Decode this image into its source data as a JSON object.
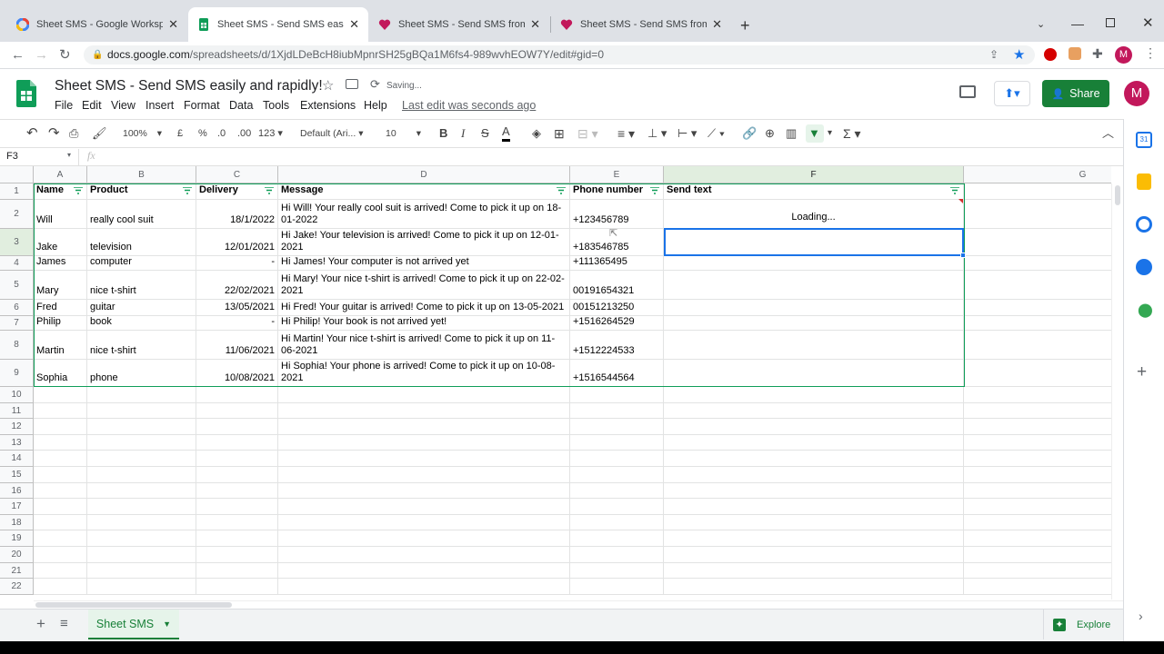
{
  "browser": {
    "tabs": [
      {
        "title": "Sheet SMS - Google Workspace M",
        "icon": "google-workspace-icon"
      },
      {
        "title": "Sheet SMS - Send SMS easily and",
        "icon": "sheets-icon"
      },
      {
        "title": "Sheet SMS - Send SMS from Goo",
        "icon": "heart-icon"
      },
      {
        "title": "Sheet SMS - Send SMS from Goo",
        "icon": "heart-icon"
      }
    ],
    "url_host": "docs.google.com",
    "url_path": "/spreadsheets/d/1XjdLDeBcH8iubMpnrSH25gBQa1M6fs4-989wvhEOW7Y/edit#gid=0",
    "profile_initial": "M"
  },
  "doc": {
    "title": "Sheet SMS - Send SMS easily and rapidly!",
    "status": "Saving...",
    "last_edit": "Last edit was seconds ago",
    "share_label": "Share",
    "avatar_initial": "M",
    "menu": [
      "File",
      "Edit",
      "View",
      "Insert",
      "Format",
      "Data",
      "Tools",
      "Extensions",
      "Help"
    ]
  },
  "toolbar": {
    "zoom": "100%",
    "currency": "£",
    "percent": "%",
    "dec_decrease": ".0",
    "dec_increase": ".00",
    "more_formats": "123",
    "font": "Default (Ari...",
    "font_size": "10"
  },
  "formula_bar": {
    "cell_ref": "F3",
    "fx": "fx",
    "value": ""
  },
  "grid": {
    "columns": [
      "A",
      "B",
      "C",
      "D",
      "E",
      "F",
      "G"
    ],
    "headers": [
      "Name",
      "Product",
      "Delivery",
      "Message",
      "Phone number",
      "Send text"
    ],
    "rows": [
      {
        "n": "2",
        "name": "Will",
        "product": "really cool suit",
        "delivery": "18/1/2022",
        "message": "Hi Will! Your really cool suit is arrived! Come to pick it up on 18-01-2022",
        "phone": "+123456789",
        "send": "Loading..."
      },
      {
        "n": "3",
        "name": "Jake",
        "product": "television",
        "delivery": "12/01/2021",
        "message": "Hi Jake! Your television is arrived! Come to pick it up on 12-01-2021",
        "phone": "+183546785",
        "send": ""
      },
      {
        "n": "4",
        "name": "James",
        "product": "computer",
        "delivery": "-",
        "message": "Hi James! Your computer is not arrived yet",
        "phone": "+111365495",
        "send": ""
      },
      {
        "n": "5",
        "name": "Mary",
        "product": "nice t-shirt",
        "delivery": "22/02/2021",
        "message": "Hi Mary! Your nice t-shirt is arrived! Come to pick it up on 22-02-2021",
        "phone": "00191654321",
        "send": ""
      },
      {
        "n": "6",
        "name": "Fred",
        "product": "guitar",
        "delivery": "13/05/2021",
        "message": "Hi Fred! Your guitar is arrived! Come to pick it up on 13-05-2021",
        "phone": "00151213250",
        "send": ""
      },
      {
        "n": "7",
        "name": "Philip",
        "product": "book",
        "delivery": "-",
        "message": "Hi Philip! Your book is not arrived yet!",
        "phone": "+1516264529",
        "send": ""
      },
      {
        "n": "8",
        "name": "Martin",
        "product": "nice t-shirt",
        "delivery": "11/06/2021",
        "message": "Hi Martin! Your nice t-shirt is arrived! Come to pick it up on 11-06-2021",
        "phone": "+1512224533",
        "send": ""
      },
      {
        "n": "9",
        "name": "Sophia",
        "product": "phone",
        "delivery": "10/08/2021",
        "message": "Hi Sophia! Your phone is arrived! Come to pick it up on 10-08-2021",
        "phone": "+1516544564",
        "send": ""
      }
    ],
    "empty_rows": [
      "10",
      "11",
      "12",
      "13",
      "14",
      "15",
      "16",
      "17",
      "18",
      "19",
      "20",
      "21",
      "22"
    ]
  },
  "sheets_bar": {
    "active_sheet": "Sheet SMS",
    "explore_label": "Explore"
  },
  "colors": {
    "sheets_green": "#188038",
    "selection_blue": "#1a73e8",
    "filter_green": "#0f9d58"
  }
}
